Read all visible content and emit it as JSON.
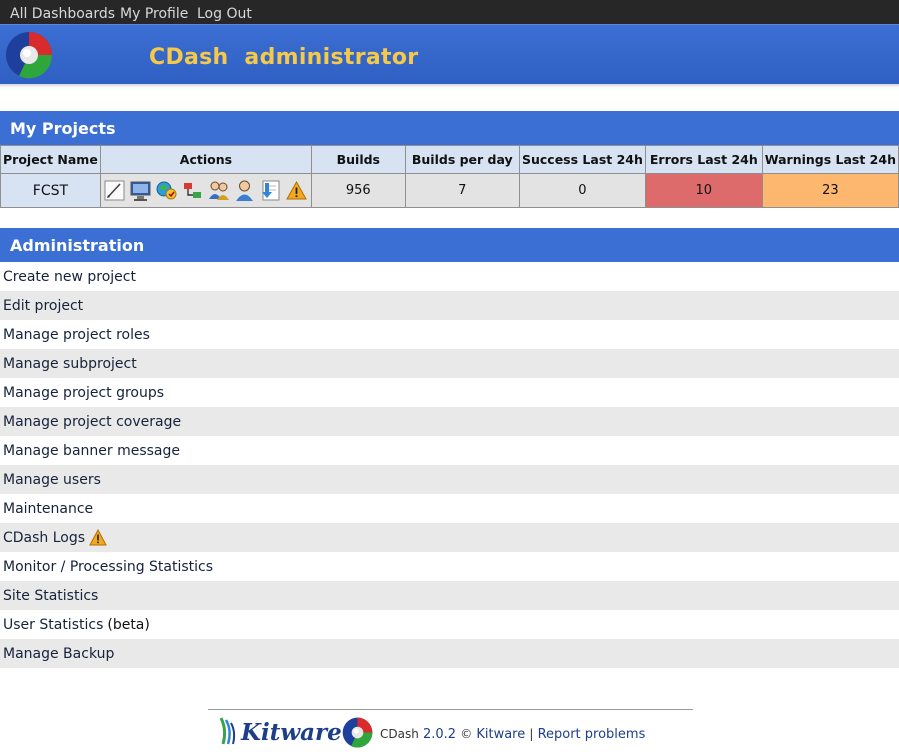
{
  "nav": {
    "all_dashboards": "All Dashboards",
    "my_profile": "My Profile",
    "log_out": "Log Out"
  },
  "header": {
    "title": "CDash  administrator"
  },
  "my_projects": {
    "title": "My Projects",
    "columns": [
      "Project Name",
      "Actions",
      "Builds",
      "Builds per day",
      "Success Last 24h",
      "Errors Last 24h",
      "Warnings Last 24h"
    ],
    "rows": [
      {
        "name": "FCST",
        "builds": "956",
        "builds_per_day": "7",
        "success": "0",
        "errors": "10",
        "warnings": "23"
      }
    ],
    "action_icons": [
      "edit-project-icon",
      "manage-builds-icon",
      "manage-groups-icon",
      "subproject-icon",
      "manage-users-icon",
      "user-icon",
      "backup-download-icon",
      "warning-icon"
    ]
  },
  "administration": {
    "title": "Administration",
    "items": [
      {
        "label": "Create new project"
      },
      {
        "label": "Edit project"
      },
      {
        "label": "Manage project roles"
      },
      {
        "label": "Manage subproject"
      },
      {
        "label": "Manage project groups"
      },
      {
        "label": "Manage project coverage"
      },
      {
        "label": "Manage banner message"
      },
      {
        "label": "Manage users"
      },
      {
        "label": "Maintenance"
      },
      {
        "label": "CDash Logs"
      },
      {
        "label": "Monitor / Processing Statistics"
      },
      {
        "label": "Site Statistics"
      },
      {
        "label": "User Statistics",
        "suffix": "(beta)"
      },
      {
        "label": "Manage Backup"
      }
    ]
  },
  "footer": {
    "brand": "Kitware",
    "product": "CDash",
    "version": "2.0.2",
    "copyright": "©",
    "company_link": "Kitware",
    "separator": "|",
    "report_link": "Report problems"
  },
  "colors": {
    "accent": "#3c6fd4",
    "header_title": "#f7c948",
    "errors_cell": "#de6b6b",
    "warnings_cell": "#fdb76f"
  }
}
